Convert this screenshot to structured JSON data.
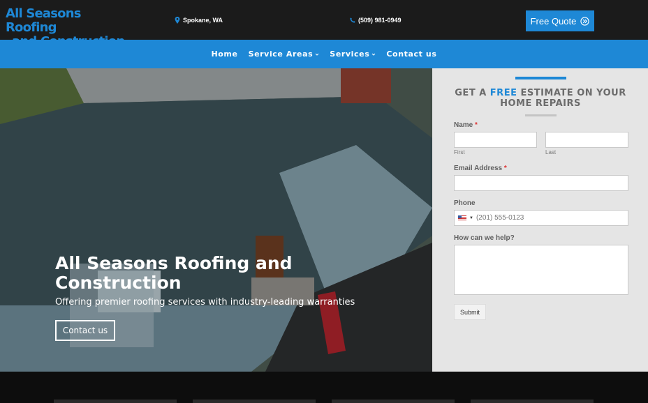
{
  "header": {
    "logo_line1": "All Seasons Roofing",
    "logo_line2": "and Construction",
    "location": "Spokane, WA",
    "phone": "(509) 981-0949",
    "quote_button": "Free Quote",
    "icons": {
      "location": "map-pin-icon",
      "phone": "phone-icon",
      "quote": "double-chevron-circle-icon"
    }
  },
  "nav": {
    "items": [
      {
        "label": "Home",
        "dropdown": false
      },
      {
        "label": "Service Areas",
        "dropdown": true
      },
      {
        "label": "Services",
        "dropdown": true
      },
      {
        "label": "Contact us",
        "dropdown": false
      }
    ]
  },
  "hero": {
    "title": "All Seasons Roofing and Construction",
    "subtitle": "Offering premier roofing services with industry-leading warranties",
    "button": "Contact us"
  },
  "form": {
    "heading_pre": "GET A ",
    "heading_highlight": "FREE",
    "heading_post": " ESTIMATE ON YOUR HOME REPAIRS",
    "name_label": "Name",
    "required_mark": "*",
    "first_sublabel": "First",
    "last_sublabel": "Last",
    "email_label": "Email Address",
    "phone_label": "Phone",
    "phone_placeholder": "(201) 555-0123",
    "help_label": "How can we help?",
    "submit": "Submit"
  },
  "colors": {
    "brand_blue": "#1e88d6",
    "topbar": "#1b1b1b",
    "form_bg": "#e5e5e5"
  }
}
